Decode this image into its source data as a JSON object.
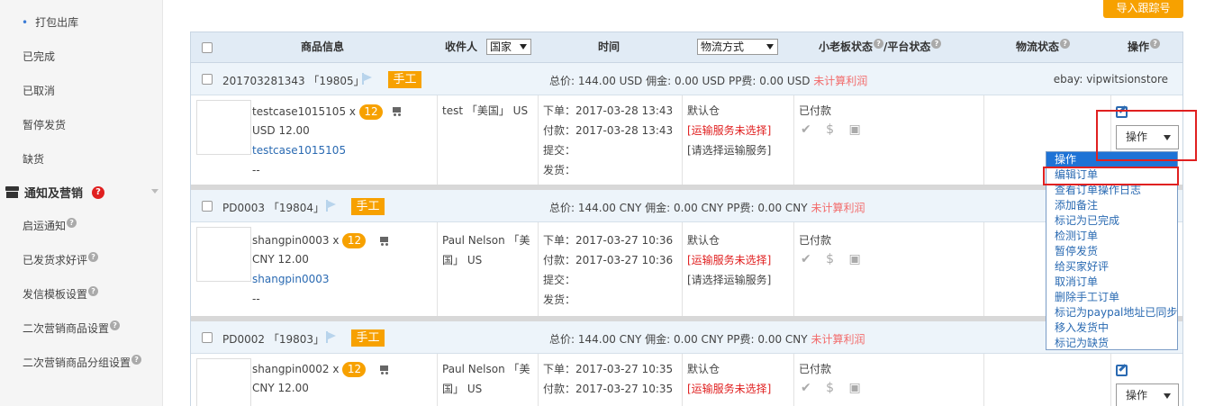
{
  "sidebar": {
    "items": [
      {
        "label": "打包出库",
        "bullet": true
      },
      {
        "label": "已完成"
      },
      {
        "label": "已取消"
      },
      {
        "label": "暂停发货"
      },
      {
        "label": "缺货"
      }
    ],
    "group": {
      "label": "通知及营销",
      "help": "?"
    },
    "group_items": [
      {
        "label": "启运通知",
        "help": "?"
      },
      {
        "label": "已发货求好评",
        "help": "?"
      },
      {
        "label": "发信模板设置",
        "help": "?"
      },
      {
        "label": "二次营销商品设置",
        "help": "?"
      },
      {
        "label": "二次营销商品分组设置",
        "help": "?"
      }
    ]
  },
  "toolbar": {
    "import_tracking": "导入跟踪号"
  },
  "table": {
    "headers": {
      "product_info": "商品信息",
      "recipient": "收件人",
      "country_select": "国家",
      "time": "时间",
      "shipping_select": "物流方式",
      "status": "小老板状态",
      "platform_status": "/平台状态",
      "logistics_status": "物流状态",
      "actions": "操作",
      "help": "?"
    },
    "orders": [
      {
        "id": "201703281343 「19805」",
        "tag": "手工",
        "total": "总价: 144.00 USD  佣金: 0.00 USD  PP费: 0.00 USD",
        "profit_note": "未计算利润",
        "store": "ebay: vipwitsionstore",
        "sku": "testcase1015105 x",
        "qty": "12",
        "price": "USD 12.00",
        "sku_link": "testcase1015105",
        "dash": "--",
        "recipient_line1": "test 「美国」 US",
        "recipient_line2": "",
        "order_time": "下单：2017-03-28 13:43",
        "pay_time": "付款：2017-03-28 13:43",
        "submit_time": "提交：",
        "ship_time": "发货：",
        "warehouse": "默认仓",
        "shipping_unset": "[运输服务未选择]",
        "shipping_choose": "[请选择运输服务]",
        "pay_status": "已付款",
        "status_icons": "✔ $ ▣",
        "op_label": "操作"
      },
      {
        "id": "PD0003 「19804」",
        "tag": "手工",
        "total": "总价: 144.00 CNY  佣金: 0.00 CNY  PP费: 0.00 CNY",
        "profit_note": "未计算利润",
        "sku": "shangpin0003 x",
        "qty": "12",
        "price": "CNY 12.00",
        "sku_link": "shangpin0003",
        "dash": "--",
        "recipient_line1": "Paul Nelson 「美",
        "recipient_line2": "国」 US",
        "order_time": "下单：2017-03-27 10:36",
        "pay_time": "付款：2017-03-27 10:36",
        "submit_time": "提交：",
        "ship_time": "发货：",
        "warehouse": "默认仓",
        "shipping_unset": "[运输服务未选择]",
        "shipping_choose": "[请选择运输服务]",
        "pay_status": "已付款",
        "status_icons": "✔ $ ▣"
      },
      {
        "id": "PD0002 「19803」",
        "tag": "手工",
        "total": "总价: 144.00 CNY  佣金: 0.00 CNY  PP费: 0.00 CNY",
        "profit_note": "未计算利润",
        "sku": "shangpin0002 x",
        "qty": "12",
        "price": "CNY 12.00",
        "recipient_line1": "Paul Nelson 「美",
        "recipient_line2": "国」 US",
        "order_time": "下单：2017-03-27 10:35",
        "pay_time": "付款：2017-03-27 10:35",
        "warehouse": "默认仓",
        "shipping_unset": "[运输服务未选择]",
        "pay_status": "已付款",
        "status_icons": "✔ $ ▣",
        "op_label": "操作"
      }
    ]
  },
  "dropdown": {
    "items": [
      "操作",
      "编辑订单",
      "查看订单操作日志",
      "添加备注",
      "标记为已完成",
      "检测订单",
      "暂停发货",
      "给买家好评",
      "取消订单",
      "删除手工订单",
      "标记为paypal地址已同步",
      "移入发货中",
      "标记为缺货"
    ]
  },
  "colors": {
    "accent": "#f7a100",
    "link": "#2a6ab2",
    "warn": "#e02020",
    "header_bg": "#e1ebf5"
  }
}
